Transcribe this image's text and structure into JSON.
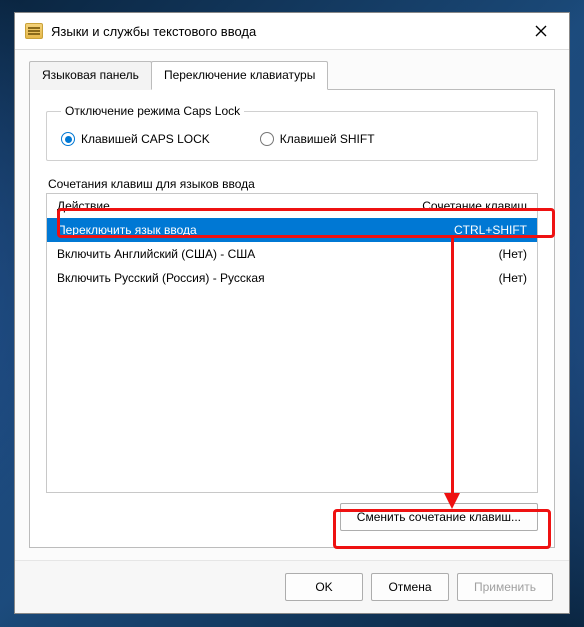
{
  "window": {
    "title": "Языки и службы текстового ввода"
  },
  "tabs": {
    "lang_panel": "Языковая панель",
    "switch_kbd": "Переключение клавиатуры"
  },
  "capslock": {
    "legend": "Отключение режима Caps Lock",
    "opt_caps": "Клавишей CAPS LOCK",
    "opt_shift": "Клавишей SHIFT"
  },
  "hotkeys": {
    "group_label": "Сочетания клавиш для языков ввода",
    "hdr_action": "Действие",
    "hdr_key": "Сочетание клавиш",
    "rows": [
      {
        "action": "Переключить язык ввода",
        "key": "CTRL+SHIFT"
      },
      {
        "action": "Включить Английский (США) - США",
        "key": "(Нет)"
      },
      {
        "action": "Включить Русский (Россия) - Русская",
        "key": "(Нет)"
      }
    ],
    "change_btn": "Сменить сочетание клавиш..."
  },
  "footer": {
    "ok": "OK",
    "cancel": "Отмена",
    "apply": "Применить"
  }
}
